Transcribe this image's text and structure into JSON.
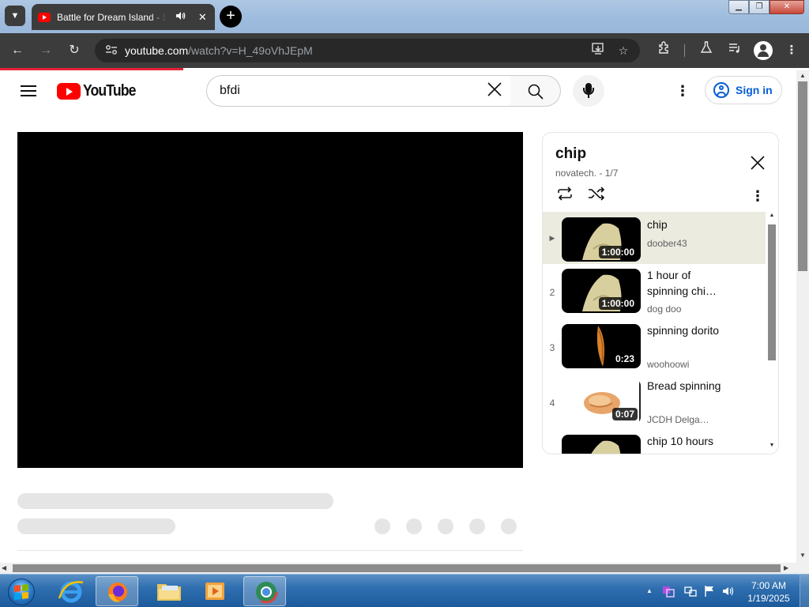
{
  "browser": {
    "tab_title": "Battle for Dream Island - Se",
    "tab_audio_icon": "speaker-icon",
    "new_tab_label": "+",
    "url_host": "youtube.com",
    "url_path": "/watch?v=H_49oVhJEpM",
    "window_buttons": [
      "minimize",
      "restore",
      "close"
    ]
  },
  "youtube": {
    "logo_text": "YouTube",
    "search_value": "bfdi",
    "signin_label": "Sign in",
    "brand_color": "#ff0000",
    "link_color": "#065fd4"
  },
  "playlist": {
    "title": "chip",
    "subtitle": "novatech. - 1/7",
    "items": [
      {
        "index": "▶",
        "title": "chip",
        "channel": "doober43",
        "duration": "1:00:00",
        "active": true
      },
      {
        "index": "2",
        "title": "1 hour of spinning chi…",
        "channel": "dog doo",
        "duration": "1:00:00",
        "active": false
      },
      {
        "index": "3",
        "title": "spinning dorito",
        "channel": "woohoowi",
        "duration": "0:23",
        "active": false
      },
      {
        "index": "4",
        "title": "Bread spinning",
        "channel": "JCDH Delga…",
        "duration": "0:07",
        "active": false
      },
      {
        "index": "5",
        "title": "chip 10 hours",
        "channel": "",
        "duration": "",
        "active": false
      }
    ]
  },
  "taskbar": {
    "time": "7:00 AM",
    "date": "1/19/2025",
    "apps": [
      "internet-explorer",
      "firefox",
      "file-explorer",
      "media-player",
      "chrome"
    ]
  }
}
